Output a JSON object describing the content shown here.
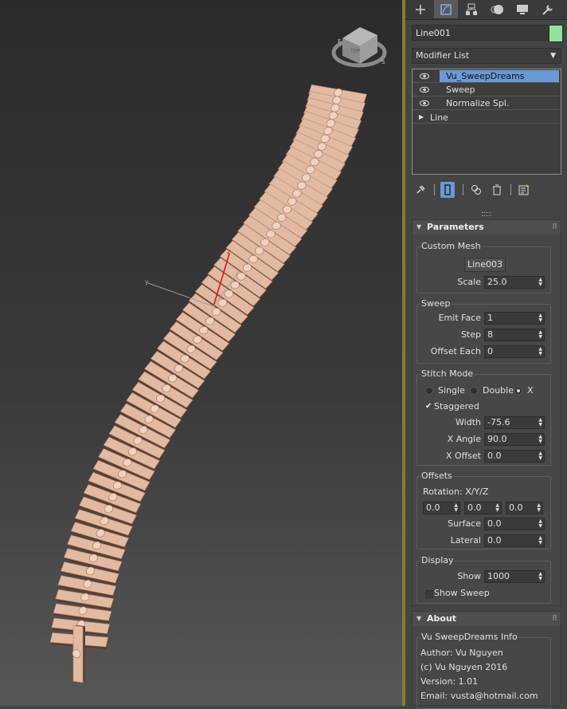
{
  "viewport": {
    "gizmo_axis_z": "z",
    "gizmo_axis_y": "y",
    "viewcube_label": "TOP"
  },
  "panel": {
    "object_name": "Line001",
    "object_color": "#8fe39a",
    "modifier_list_label": "Modifier List",
    "stack": [
      {
        "label": "Vu_SweepDreams",
        "visible": true,
        "selected": true
      },
      {
        "label": "Sweep",
        "visible": true,
        "selected": false
      },
      {
        "label": "Normalize Spl.",
        "visible": true,
        "selected": false
      },
      {
        "label": "Line",
        "visible": false,
        "expandable": true,
        "selected": false
      }
    ],
    "parameters": {
      "title": "Parameters",
      "custom_mesh": {
        "title": "Custom Mesh",
        "pick_button": "Line003",
        "scale_label": "Scale",
        "scale": "25.0"
      },
      "sweep": {
        "title": "Sweep",
        "emit_face_label": "Emit Face",
        "emit_face": "1",
        "step_label": "Step",
        "step": "8",
        "offset_each_label": "Offset Each",
        "offset_each": "0"
      },
      "stitch": {
        "title": "Stitch Mode",
        "single_label": "Single",
        "double_label": "Double",
        "x_label": "X",
        "selected": "X",
        "staggered_label": "Staggered",
        "staggered": true,
        "width_label": "Width",
        "width": "-75.6",
        "xangle_label": "X Angle",
        "xangle": "90.0",
        "xoffset_label": "X Offset",
        "xoffset": "0.0"
      },
      "offsets": {
        "title": "Offsets",
        "rotation_label": "Rotation: X/Y/Z",
        "rot_x": "0.0",
        "rot_y": "0.0",
        "rot_z": "0.0",
        "surface_label": "Surface",
        "surface": "0.0",
        "lateral_label": "Lateral",
        "lateral": "0.0"
      },
      "display": {
        "title": "Display",
        "show_label": "Show",
        "show": "1000",
        "show_sweep_label": "Show Sweep",
        "show_sweep": false
      }
    },
    "about": {
      "title": "About",
      "group_title": "Vu SweepDreams Info",
      "author": "Author: Vu Nguyen",
      "copyright": "(c) Vu Nguyen 2016",
      "version": "Version: 1.01",
      "email": "Email: vusta@hotmail.com"
    }
  },
  "colors": {
    "selection": "#6a9ad6",
    "viewport_border": "#8a7a2e",
    "mesh": "#e2b9a1"
  }
}
